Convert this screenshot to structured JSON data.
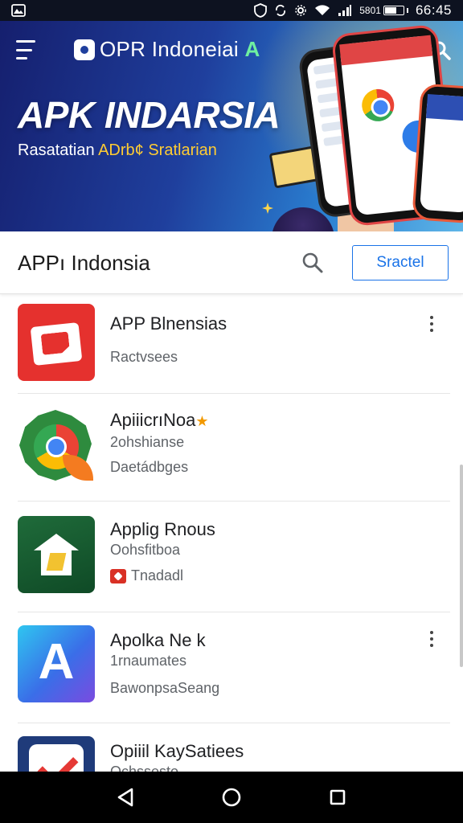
{
  "status_bar": {
    "time": "66:45",
    "battery_text": "5801"
  },
  "banner": {
    "brand_name": "OPR Indoneiai",
    "brand_accent": "A",
    "headline": "APK INDARSIA",
    "subline_start": "Rasatatian ",
    "subline_highlight": "ADrb¢ Sratlarian"
  },
  "search_header": {
    "title": "APPı Indonsia",
    "action_label": "Sractel"
  },
  "apps": [
    {
      "name": "APP Blnensias",
      "sub": "",
      "meta": "Ractvsees",
      "has_more": true,
      "rating_star": false,
      "badge": false
    },
    {
      "name": "ApiiicrıNoa",
      "sub": "2ohshianse",
      "meta": "Daetádbges",
      "has_more": false,
      "rating_star": true,
      "badge": false
    },
    {
      "name": "Applig Rnous",
      "sub": "Oohsfitboa",
      "meta": "Tnadadl",
      "has_more": false,
      "rating_star": false,
      "badge": true
    },
    {
      "name": "Apolka Ne k",
      "sub": "1rnaumates",
      "meta": "BawonpsaSeang",
      "has_more": true,
      "rating_star": false,
      "badge": false
    },
    {
      "name": "Opiiil KaySatiees",
      "sub": "Ochssesto",
      "meta": "",
      "has_more": false,
      "rating_star": false,
      "badge": false
    }
  ],
  "icons": {
    "status_left": "photo-icon",
    "menu": "hamburger-menu-icon",
    "search": "search-icon",
    "more": "more-vertical-icon",
    "nav_back": "back-triangle-icon",
    "nav_home": "home-circle-icon",
    "nav_recent": "recent-apps-square-icon"
  },
  "colors": {
    "accent": "#1a73e8",
    "banner_start": "#151f6e",
    "banner_end": "#5fb6e8",
    "star": "#f29900"
  }
}
